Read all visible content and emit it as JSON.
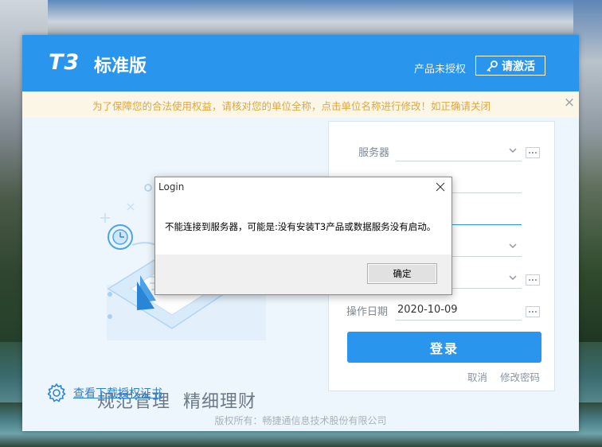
{
  "header": {
    "logo_mark": "T3",
    "product_name": "标准版",
    "license_status": "产品未授权",
    "activate_label": "请激活"
  },
  "notice": {
    "text": "为了保障您的合法使用权益，请核对您的单位全称，点击单位名称进行修改！如正确请关闭",
    "close_symbol": "×"
  },
  "promo": {
    "slogan_left": "规范管理",
    "slogan_right": "精细理财"
  },
  "cert_link": {
    "label": "查看下载授权证书",
    "icon": "gear-icon"
  },
  "login": {
    "server_label": "服务器",
    "server_value": "",
    "date_label": "操作日期",
    "date_value": "2020-10-09",
    "login_label": "登录",
    "cancel_label": "取消",
    "change_password_label": "修改密码"
  },
  "footer": {
    "text": "版权所有：畅捷通信息技术股份有限公司"
  },
  "dialog": {
    "title": "Login",
    "message": "不能连接到服务器，可能是:没有安装T3产品或数据服务没有启动。",
    "ok_label": "确定"
  },
  "colors": {
    "brand_blue": "#2a95ec",
    "notice_text": "#e0a640",
    "notice_bg": "#fcf6e6"
  }
}
